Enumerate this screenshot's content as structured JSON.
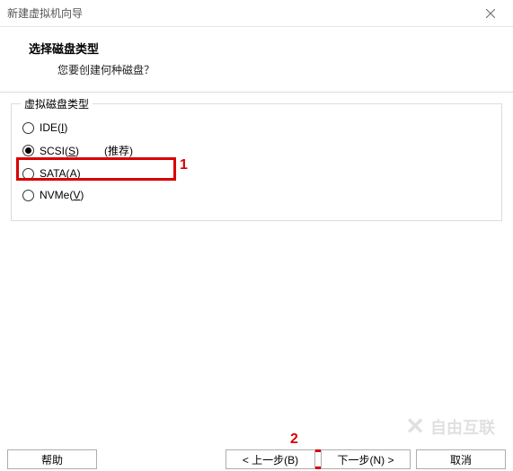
{
  "window": {
    "title": "新建虚拟机向导"
  },
  "header": {
    "title": "选择磁盘类型",
    "subtitle": "您要创建何种磁盘？"
  },
  "group": {
    "legend": "虚拟磁盘类型"
  },
  "options": {
    "ide": {
      "prefix": "IDE(",
      "accel": "I",
      "suffix": ")"
    },
    "scsi": {
      "prefix": "SCSI(",
      "accel": "S",
      "suffix": ")",
      "recommend": "(推荐)"
    },
    "sata": {
      "prefix": "SATA(",
      "accel": "A",
      "suffix": ")"
    },
    "nvme": {
      "prefix": "NVMe(",
      "accel": "V",
      "suffix": ")"
    }
  },
  "annotations": {
    "one": "1",
    "two": "2"
  },
  "buttons": {
    "help": "帮助",
    "back": "< 上一步(B)",
    "next": "下一步(N) >",
    "cancel": "取消"
  },
  "watermark": {
    "text": "自由互联"
  }
}
